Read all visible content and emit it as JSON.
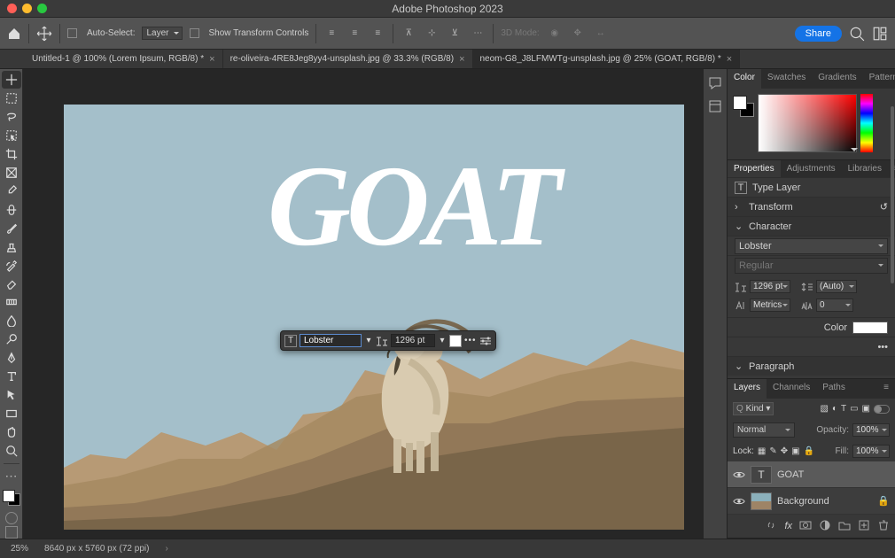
{
  "app_title": "Adobe Photoshop 2023",
  "options": {
    "auto_select_label": "Auto-Select:",
    "auto_select_value": "Layer",
    "show_transform": "Show Transform Controls",
    "mode_label": "3D Mode:",
    "share": "Share"
  },
  "tabs": [
    {
      "label": "Untitled-1 @ 100% (Lorem Ipsum, RGB/8) *",
      "active": false
    },
    {
      "label": "re-oliveira-4RE8Jeg8yy4-unsplash.jpg @ 33.3% (RGB/8)",
      "active": false
    },
    {
      "label": "neom-G8_J8LFMWTg-unsplash.jpg @ 25% (GOAT, RGB/8) *",
      "active": true
    }
  ],
  "canvas": {
    "text": "GOAT"
  },
  "hud": {
    "font": "Lobster",
    "size": "1296 pt"
  },
  "panel_color": {
    "tabs": [
      "Color",
      "Swatches",
      "Gradients",
      "Patterns"
    ]
  },
  "panel_props": {
    "tabs": [
      "Properties",
      "Adjustments",
      "Libraries"
    ],
    "type_label": "Type Layer",
    "transform": "Transform",
    "character": "Character",
    "font": "Lobster",
    "style": "Regular",
    "size": "1296 pt",
    "leading": "(Auto)",
    "tracking": "Metrics",
    "kerning": "0",
    "color_label": "Color",
    "paragraph": "Paragraph"
  },
  "panel_layers": {
    "tabs": [
      "Layers",
      "Channels",
      "Paths"
    ],
    "kind": "Kind",
    "blend": "Normal",
    "opacity_label": "Opacity:",
    "opacity": "100%",
    "lock_label": "Lock:",
    "fill_label": "Fill:",
    "fill": "100%",
    "layers": [
      {
        "name": "GOAT",
        "type": "T",
        "selected": true
      },
      {
        "name": "Background",
        "type": "img",
        "locked": true
      }
    ]
  },
  "status": {
    "zoom": "25%",
    "dims": "8640 px x 5760 px (72 ppi)"
  }
}
